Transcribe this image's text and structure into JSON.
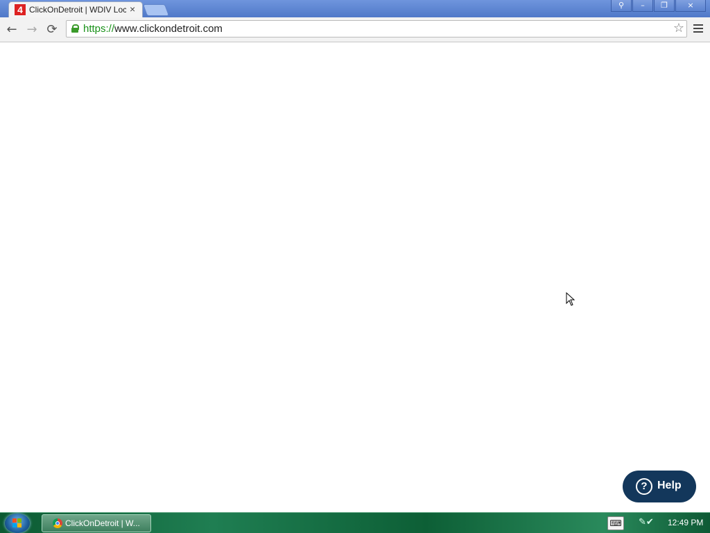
{
  "browser": {
    "tab": {
      "favicon_text": "4",
      "title": "ClickOnDetroit | WDIV Local News",
      "close_glyph": "×"
    },
    "window_buttons": {
      "user": "⚲",
      "minimize": "–",
      "restore": "❐",
      "close": "×"
    },
    "nav": {
      "back": "←",
      "forward": "→",
      "reload": "⟳"
    },
    "address": {
      "scheme": "https://",
      "host": "www.clickondetroit.com"
    },
    "star_glyph": "☆"
  },
  "page": {
    "help_button": {
      "icon": "?",
      "label": "Help"
    }
  },
  "taskbar": {
    "active_task": "ClickOnDetroit | W...",
    "keyboard_icon": "⌨",
    "tray_icons": "✎✔",
    "clock": "12:49 PM"
  },
  "colors": {
    "help_bg": "#13375b",
    "url_scheme": "#189118",
    "titlebar": "#5b83d0",
    "taskbar": "#1a6b44"
  }
}
